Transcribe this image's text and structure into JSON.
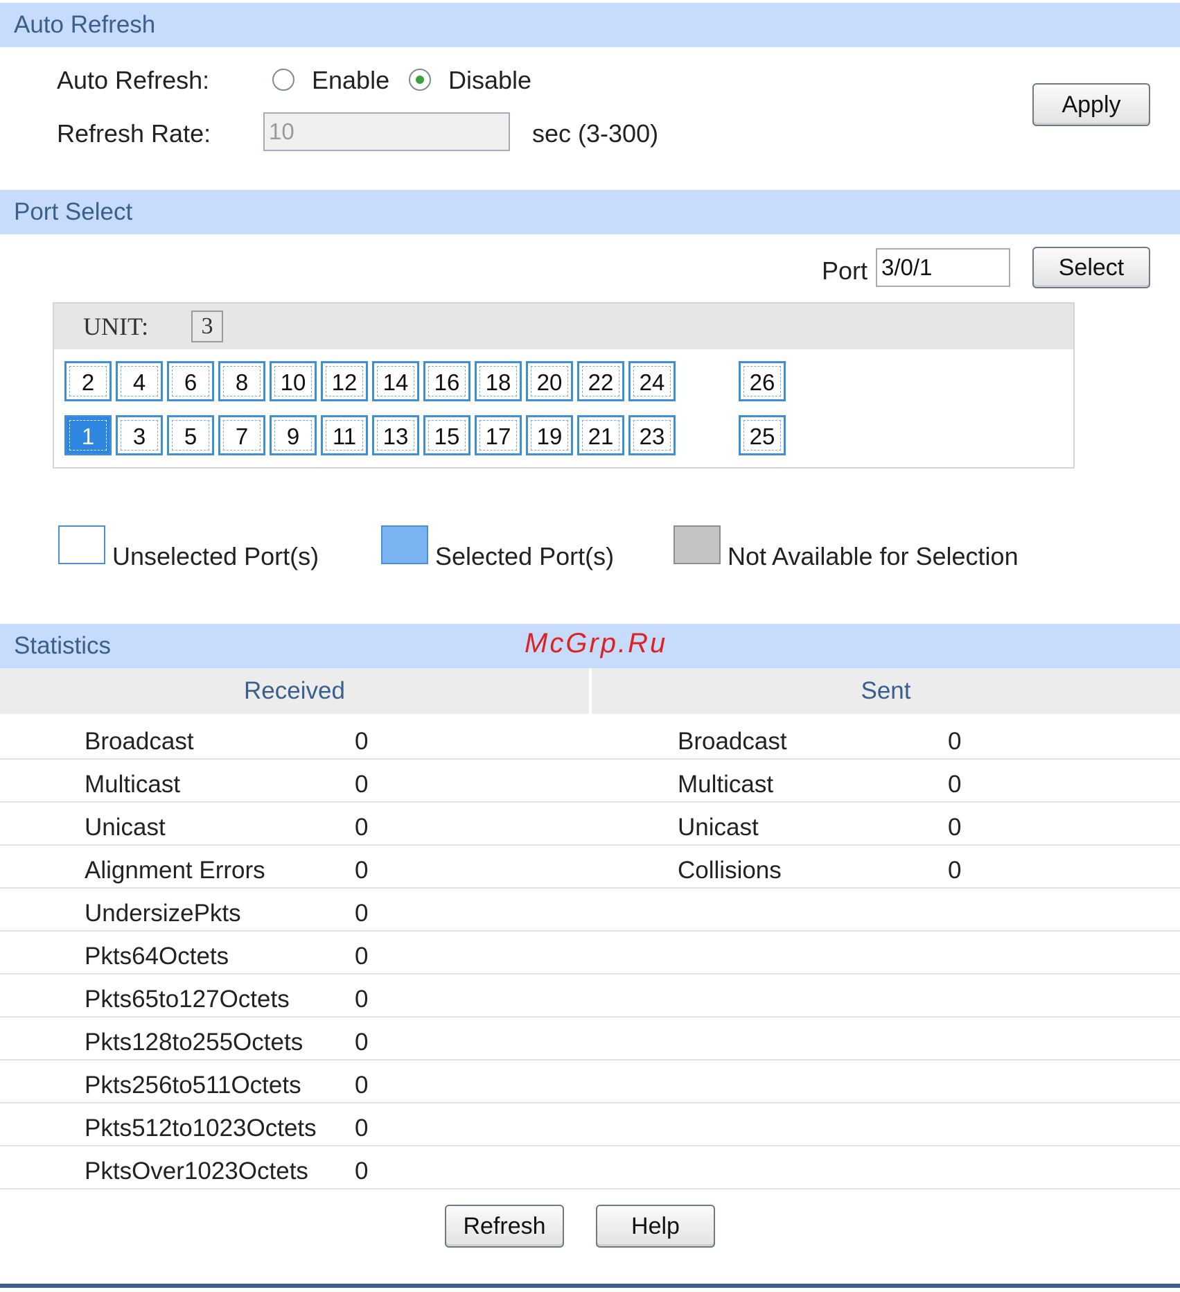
{
  "auto_refresh": {
    "header": "Auto Refresh",
    "label": "Auto Refresh:",
    "enable_label": "Enable",
    "disable_label": "Disable",
    "selected": "Disable",
    "rate_label": "Refresh Rate:",
    "rate_value": "10",
    "rate_unit": "sec (3-300)",
    "apply_label": "Apply"
  },
  "port_select": {
    "header": "Port Select",
    "port_label": "Port",
    "port_value": "3/0/1",
    "select_label": "Select",
    "unit_label": "UNIT:",
    "unit_value": "3",
    "top_row": [
      "2",
      "4",
      "6",
      "8",
      "10",
      "12",
      "14",
      "16",
      "18",
      "20",
      "22",
      "24"
    ],
    "bottom_row": [
      "1",
      "3",
      "5",
      "7",
      "9",
      "11",
      "13",
      "15",
      "17",
      "19",
      "21",
      "23"
    ],
    "extra_top": "26",
    "extra_bottom": "25",
    "selected_port": "1",
    "legend": {
      "unselected": "Unselected Port(s)",
      "selected": "Selected Port(s)",
      "not_available": "Not Available for Selection"
    }
  },
  "statistics": {
    "header": "Statistics",
    "received_header": "Received",
    "sent_header": "Sent",
    "received": [
      {
        "name": "Broadcast",
        "value": "0"
      },
      {
        "name": "Multicast",
        "value": "0"
      },
      {
        "name": "Unicast",
        "value": "0"
      },
      {
        "name": "Alignment Errors",
        "value": "0"
      },
      {
        "name": "UndersizePkts",
        "value": "0"
      },
      {
        "name": "Pkts64Octets",
        "value": "0"
      },
      {
        "name": "Pkts65to127Octets",
        "value": "0"
      },
      {
        "name": "Pkts128to255Octets",
        "value": "0"
      },
      {
        "name": "Pkts256to511Octets",
        "value": "0"
      },
      {
        "name": "Pkts512to1023Octets",
        "value": "0"
      },
      {
        "name": "PktsOver1023Octets",
        "value": "0"
      }
    ],
    "sent": [
      {
        "name": "Broadcast",
        "value": "0"
      },
      {
        "name": "Multicast",
        "value": "0"
      },
      {
        "name": "Unicast",
        "value": "0"
      },
      {
        "name": "Collisions",
        "value": "0"
      }
    ]
  },
  "footer": {
    "refresh_label": "Refresh",
    "help_label": "Help"
  },
  "watermark": "McGrp.Ru",
  "colors": {
    "header_bg": "#c7dcfc",
    "header_text": "#3a5f8c",
    "port_border": "#3d8fd6",
    "port_selected": "#2e86e0"
  }
}
